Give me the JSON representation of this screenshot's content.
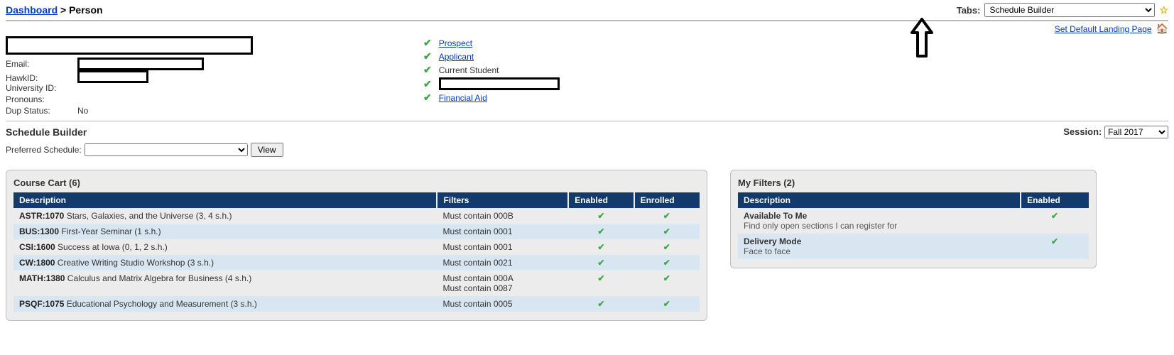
{
  "breadcrumb": {
    "dashboard": "Dashboard",
    "sep": ">",
    "current": "Person"
  },
  "tabs": {
    "label": "Tabs:",
    "selected": "Schedule Builder"
  },
  "landing": {
    "link": "Set Default Landing Page"
  },
  "person": {
    "labels": {
      "email": "Email:",
      "hawkid": "HawkID:",
      "univid": "University ID:",
      "pronouns": "Pronouns:",
      "dupstatus": "Dup Status:"
    },
    "dupstatus_val": "No"
  },
  "statuses": {
    "prospect": "Prospect",
    "applicant": "Applicant",
    "current": "Current Student",
    "finaid": "Financial Aid"
  },
  "schedule_builder": {
    "title": "Schedule Builder",
    "pref_label": "Preferred Schedule:",
    "view_btn": "View",
    "session_label": "Session:",
    "session_selected": "Fall 2017"
  },
  "course_cart": {
    "title": "Course Cart (6)",
    "headers": {
      "desc": "Description",
      "filters": "Filters",
      "enabled": "Enabled",
      "enrolled": "Enrolled"
    },
    "rows": [
      {
        "code": "ASTR:1070",
        "title": "Stars, Galaxies, and the Universe (3, 4 s.h.)",
        "filters": [
          "Must contain 000B"
        ],
        "enabled": true,
        "enrolled": true
      },
      {
        "code": "BUS:1300",
        "title": "First-Year Seminar (1 s.h.)",
        "filters": [
          "Must contain 0001"
        ],
        "enabled": true,
        "enrolled": true
      },
      {
        "code": "CSI:1600",
        "title": "Success at Iowa (0, 1, 2 s.h.)",
        "filters": [
          "Must contain 0001"
        ],
        "enabled": true,
        "enrolled": true
      },
      {
        "code": "CW:1800",
        "title": "Creative Writing Studio Workshop (3 s.h.)",
        "filters": [
          "Must contain 0021"
        ],
        "enabled": true,
        "enrolled": true
      },
      {
        "code": "MATH:1380",
        "title": "Calculus and Matrix Algebra for Business (4 s.h.)",
        "filters": [
          "Must contain 000A",
          "Must contain 0087"
        ],
        "enabled": true,
        "enrolled": true
      },
      {
        "code": "PSQF:1075",
        "title": "Educational Psychology and Measurement (3 s.h.)",
        "filters": [
          "Must contain 0005"
        ],
        "enabled": true,
        "enrolled": true
      }
    ]
  },
  "my_filters": {
    "title": "My Filters (2)",
    "headers": {
      "desc": "Description",
      "enabled": "Enabled"
    },
    "rows": [
      {
        "name": "Available To Me",
        "sub": "Find only open sections I can register for",
        "enabled": true
      },
      {
        "name": "Delivery Mode",
        "sub": "Face to face",
        "enabled": true
      }
    ]
  }
}
